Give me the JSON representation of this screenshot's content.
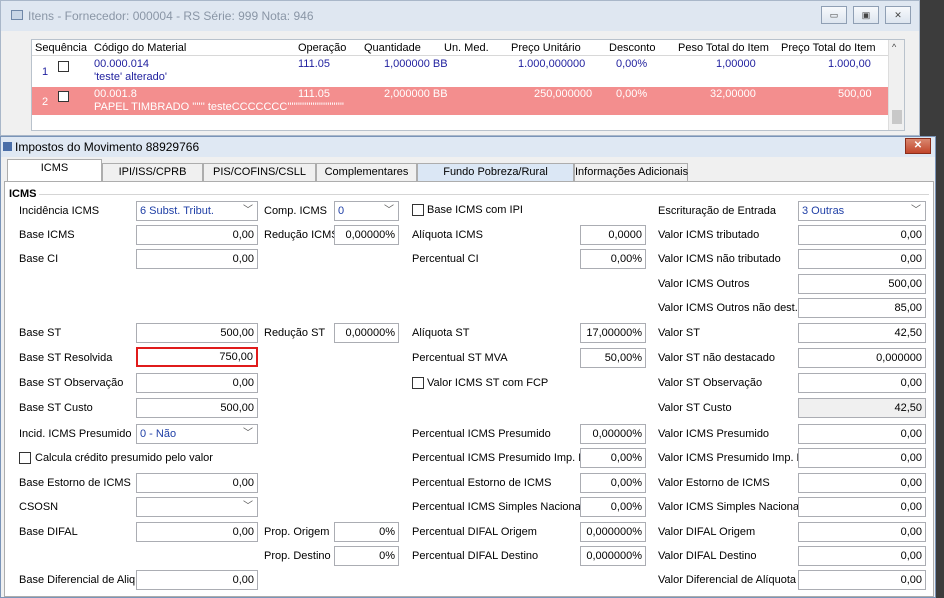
{
  "back_window": {
    "title": "Itens - Fornecedor: 000004 - RS Série: 999  Nota: 946",
    "minimize": "▭",
    "maximize": "▣",
    "close": "✕",
    "columns": [
      "Sequência",
      "Código do Material",
      "Operação",
      "Quantidade",
      "Un. Med.",
      "Preço Unitário",
      "Desconto",
      "Peso Total do Item",
      "Preço Total do Item"
    ],
    "rows": [
      {
        "seq": "1",
        "code": "00.000.014",
        "desc": "'teste' alterado'",
        "op": "111.05",
        "qty": "1,000000 BB",
        "price": "1.000,000000",
        "disc": "0,00%",
        "weight": "1,00000",
        "total": "1.000,00"
      },
      {
        "seq": "2",
        "code": "00.001.8",
        "desc": "PAPEL TIMBRADO ''''''  testeCCCCCCC'''''''''''''''''''''''''''",
        "op": "111.05",
        "qty": "2,000000 BB",
        "price": "250,000000",
        "disc": "0,00%",
        "weight": "32,00000",
        "total": "500,00"
      }
    ],
    "scroll_up": "^"
  },
  "dialog": {
    "title": "Impostos do Movimento 88929766",
    "close": "✕",
    "tabs": [
      "ICMS",
      "IPI/ISS/CPRB",
      "PIS/COFINS/CSLL",
      "Complementares",
      "Fundo Pobreza/Rural",
      "Informações Adicionais"
    ],
    "group_label": "ICMS",
    "col1": {
      "incidencia_label": "Incidência ICMS",
      "incidencia_value": "6 Subst. Tribut.",
      "base_icms_label": "Base ICMS",
      "base_icms_value": "0,00",
      "base_ci_label": "Base CI",
      "base_ci_value": "0,00",
      "base_st_label": "Base ST",
      "base_st_value": "500,00",
      "base_st_resolvida_label": "Base ST Resolvida",
      "base_st_resolvida_value": "750,00",
      "base_st_obs_label": "Base ST Observação",
      "base_st_obs_value": "0,00",
      "base_st_custo_label": "Base ST Custo",
      "base_st_custo_value": "500,00",
      "incid_presumido_label": "Incid. ICMS Presumido",
      "incid_presumido_value": "0 - Não",
      "calcula_credito_label": "Calcula crédito presumido pelo valor",
      "base_estorno_label": "Base Estorno de ICMS",
      "base_estorno_value": "0,00",
      "csosn_label": "CSOSN",
      "csosn_value": "",
      "base_difal_label": "Base DIFAL",
      "base_difal_value": "0,00",
      "base_dif_aliq_label": "Base Diferencial de Aliq.",
      "base_dif_aliq_value": "0,00"
    },
    "col2": {
      "comp_icms_label": "Comp. ICMS",
      "comp_icms_value": "0",
      "reducao_icms_label": "Redução ICMS",
      "reducao_icms_value": "0,00000%",
      "reducao_st_label": "Redução ST",
      "reducao_st_value": "0,00000%",
      "prop_origem_label": "Prop. Origem",
      "prop_origem_value": "0%",
      "prop_destino_label": "Prop. Destino",
      "prop_destino_value": "0%"
    },
    "col3": {
      "base_icms_ipi_label": "Base ICMS com IPI",
      "aliquota_icms_label": "Alíquota ICMS",
      "aliquota_icms_value": "0,0000",
      "percentual_ci_label": "Percentual CI",
      "percentual_ci_value": "0,00%",
      "aliquota_st_label": "Alíquota ST",
      "aliquota_st_value": "17,00000%",
      "percentual_st_mva_label": "Percentual ST MVA",
      "percentual_st_mva_value": "50,00%",
      "valor_icms_st_fcp_label": "Valor ICMS ST com FCP",
      "perc_presumido_label": "Percentual ICMS Presumido",
      "perc_presumido_value": "0,00000%",
      "perc_presumido_pr_label": "Percentual ICMS Presumido Imp. PR",
      "perc_presumido_pr_value": "0,00%",
      "perc_estorno_label": "Percentual Estorno de ICMS",
      "perc_estorno_value": "0,00%",
      "perc_simples_label": "Percentual ICMS Simples Nacional",
      "perc_simples_value": "0,00%",
      "perc_difal_origem_label": "Percentual DIFAL Origem",
      "perc_difal_origem_value": "0,000000%",
      "perc_difal_destino_label": "Percentual DIFAL Destino",
      "perc_difal_destino_value": "0,000000%"
    },
    "col4": {
      "escrituracao_label": "Escrituração de Entrada",
      "escrituracao_value": "3 Outras",
      "valor_tributado_label": "Valor ICMS tributado",
      "valor_tributado_value": "0,00",
      "valor_nao_tributado_label": "Valor ICMS não tributado",
      "valor_nao_tributado_value": "0,00",
      "valor_outros_label": "Valor ICMS Outros",
      "valor_outros_value": "500,00",
      "valor_outros_nd_label": "Valor ICMS Outros não dest.",
      "valor_outros_nd_value": "85,00",
      "valor_st_label": "Valor ST",
      "valor_st_value": "42,50",
      "valor_st_nd_label": "Valor ST não destacado",
      "valor_st_nd_value": "0,000000",
      "valor_st_obs_label": "Valor ST Observação",
      "valor_st_obs_value": "0,00",
      "valor_st_custo_label": "Valor ST Custo",
      "valor_st_custo_value": "42,50",
      "valor_presumido_label": "Valor ICMS Presumido",
      "valor_presumido_value": "0,00",
      "valor_presumido_pr_label": "Valor ICMS Presumido Imp. PR",
      "valor_presumido_pr_value": "0,00",
      "valor_estorno_label": "Valor Estorno de ICMS",
      "valor_estorno_value": "0,00",
      "valor_simples_label": "Valor ICMS Simples Nacional",
      "valor_simples_value": "0,00",
      "valor_difal_origem_label": "Valor DIFAL Origem",
      "valor_difal_origem_value": "0,00",
      "valor_difal_destino_label": "Valor DIFAL Destino",
      "valor_difal_destino_value": "0,00",
      "valor_dif_aliq_label": "Valor Diferencial de Alíquota",
      "valor_dif_aliq_value": "0,00"
    },
    "highlight_color": "#e01b1b"
  }
}
